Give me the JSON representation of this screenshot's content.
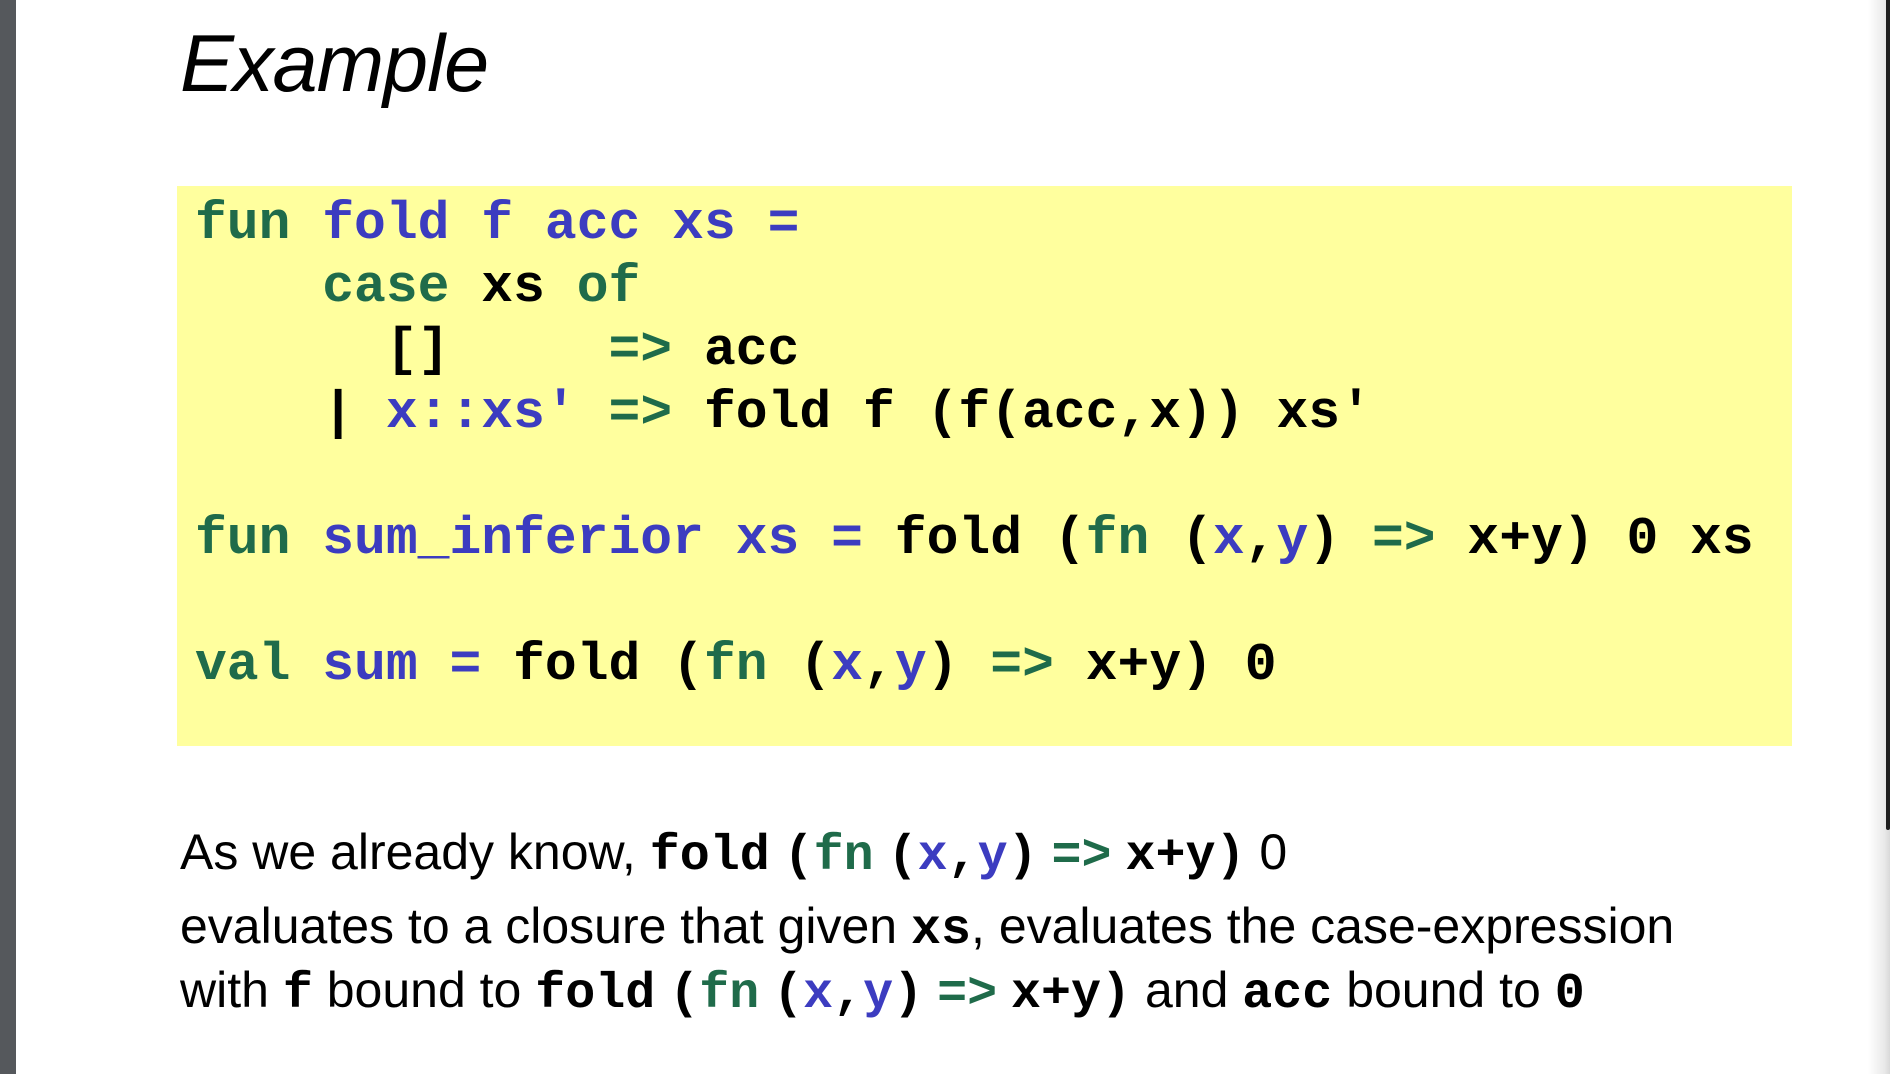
{
  "title": "Example",
  "code": {
    "l1": {
      "kw_fun": "fun",
      "fold": "fold",
      "f": "f",
      "acc": "acc",
      "xs": "xs",
      "eq": "="
    },
    "l2": {
      "kw_case": "case",
      "xs": "xs",
      "kw_of": "of"
    },
    "l3": {
      "nil": "[]",
      "arrow": "=>",
      "acc": "acc"
    },
    "l4": {
      "bar": "|",
      "pattern": "x::xs′",
      "arrow": "=>",
      "body": "fold f (f(acc,x)) xs′"
    },
    "l5": {
      "kw_fun": "fun",
      "name": "sum_inferior",
      "xs": "xs",
      "eq": "=",
      "fold": "fold",
      "open": "(",
      "kw_fn": "fn",
      "lp": "(",
      "x": "x",
      "comma": ",",
      "y": "y",
      "rp": ")",
      "arrow": "=>",
      "body": "x+y)",
      "zero": "0",
      "xs2": "xs"
    },
    "l6": {
      "kw_val": "val",
      "name": "sum",
      "eq": "=",
      "fold": "fold",
      "open": "(",
      "kw_fn": "fn",
      "lp": "(",
      "x": "x",
      "comma": ",",
      "y": "y",
      "rp": ")",
      "arrow": "=>",
      "body": "x+y)",
      "zero": "0"
    }
  },
  "paragraph": {
    "p1_text": "As we already know, ",
    "p1_fold": "fold",
    "p1_open": "(",
    "p1_fn": "fn",
    "p1_lp": "(",
    "p1_x": "x",
    "p1_comma": ",",
    "p1_y": "y",
    "p1_rp": ")",
    "p1_arrow": "=>",
    "p1_body": "x+y)",
    "p1_zero": "0",
    "p2_text1": "evaluates to a closure that given ",
    "p2_xs": "xs",
    "p2_text2": ", evaluates the case-expression",
    "p3_with": "with ",
    "p3_f": "f",
    "p3_bound": " bound to ",
    "p3_fold": "fold",
    "p3_open": "(",
    "p3_fn": "fn",
    "p3_lp": "(",
    "p3_x": "x",
    "p3_comma": ",",
    "p3_y": "y",
    "p3_rp": ")",
    "p3_arrow": "=>",
    "p3_body": "x+y)",
    "p3_and": " and ",
    "p3_acc": "acc",
    "p3_bound2": " bound to ",
    "p3_zero": "0"
  }
}
